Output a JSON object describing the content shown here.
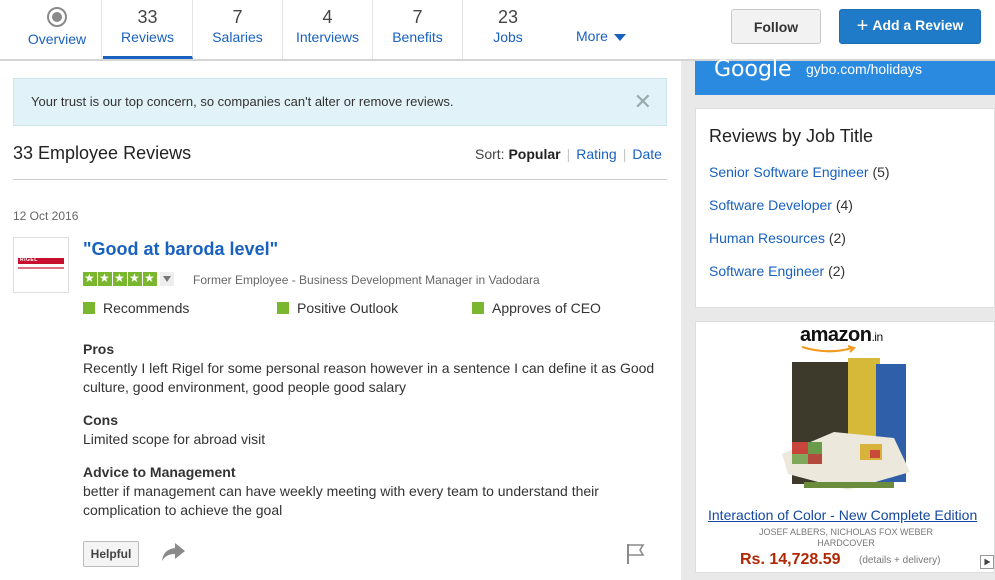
{
  "tabs": [
    {
      "count": "",
      "label": "Overview",
      "icon": "overview-icon",
      "active": false
    },
    {
      "count": "33",
      "label": "Reviews",
      "active": true
    },
    {
      "count": "7",
      "label": "Salaries",
      "active": false
    },
    {
      "count": "4",
      "label": "Interviews",
      "active": false
    },
    {
      "count": "7",
      "label": "Benefits",
      "active": false
    },
    {
      "count": "23",
      "label": "Jobs",
      "active": false
    }
  ],
  "more_label": "More",
  "follow_label": "Follow",
  "add_review_label": "Add a Review",
  "notice": {
    "text": "Your trust is our top concern, so companies can't alter or remove reviews.",
    "close_glyph": "✕"
  },
  "reviews_heading": "33 Employee Reviews",
  "sort": {
    "label": "Sort:",
    "options": [
      "Popular",
      "Rating",
      "Date"
    ],
    "selected": "Popular"
  },
  "review": {
    "date": "12 Oct 2016",
    "company_logo_text": "RIGEL",
    "title": "\"Good at baroda level\"",
    "rating": 5,
    "employee_meta": "Former Employee - Business Development Manager in Vadodara",
    "flags": [
      "Recommends",
      "Positive Outlook",
      "Approves of CEO"
    ],
    "pros_label": "Pros",
    "pros": "Recently I left Rigel for some personal reason however in a sentence I can define it as Good culture, good environment, good people good salary",
    "cons_label": "Cons",
    "cons": "Limited scope for abroad visit",
    "advice_label": "Advice to Management",
    "advice": "better if management can have weekly meeting with every team to understand their complication to achieve the goal",
    "helpful_label": "Helpful"
  },
  "google_banner": {
    "logo": "Google",
    "url": "gybo.com/holidays"
  },
  "job_titles": {
    "heading": "Reviews by Job Title",
    "items": [
      {
        "title": "Senior Software Engineer",
        "count": "(5)"
      },
      {
        "title": "Software Developer",
        "count": "(4)"
      },
      {
        "title": "Human Resources",
        "count": "(2)"
      },
      {
        "title": "Software Engineer",
        "count": "(2)"
      }
    ]
  },
  "ad": {
    "brand": "amazon",
    "brand_tld": ".in",
    "title": "Interaction of Color - New Complete Edition",
    "author_line1": "JOSEF ALBERS, NICHOLAS FOX WEBER",
    "author_line2": "HARDCOVER",
    "price": "Rs. 14,728.59",
    "details": "(details + delivery)"
  },
  "colors": {
    "link": "#1861bf",
    "accent_green": "#7ab72e",
    "primary_button": "#1f7ac7",
    "price": "#b12704",
    "google_banner": "#2a8ae0"
  }
}
